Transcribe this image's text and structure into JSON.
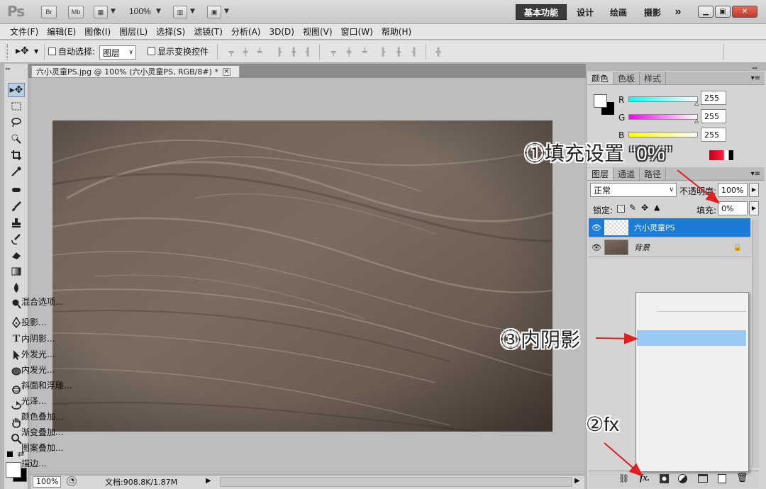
{
  "titlebar": {
    "app_logo": "Ps",
    "btn_br": "Br",
    "btn_mb": "Mb",
    "zoom": "100%",
    "workspaces": [
      "基本功能",
      "设计",
      "绘画",
      "摄影"
    ],
    "more": "»"
  },
  "menubar": [
    "文件(F)",
    "编辑(E)",
    "图像(I)",
    "图层(L)",
    "选择(S)",
    "滤镜(T)",
    "分析(A)",
    "3D(D)",
    "视图(V)",
    "窗口(W)",
    "帮助(H)"
  ],
  "options": {
    "auto_select_label": "自动选择:",
    "auto_select_value": "图层",
    "show_transform_label": "显示变换控件"
  },
  "document": {
    "tab_title": "六小灵童PS.jpg @ 100% (六小灵童PS, RGB/8#) *",
    "close": "×",
    "status_zoom": "100%",
    "status_doc": "文档:908.8K/1.87M"
  },
  "color_panel": {
    "tabs": [
      "颜色",
      "色板",
      "样式"
    ],
    "r_label": "R",
    "g_label": "G",
    "b_label": "B",
    "r_value": "255",
    "g_value": "255",
    "b_value": "255"
  },
  "layers_panel": {
    "tabs": [
      "图层",
      "通道",
      "路径"
    ],
    "blend_mode": "正常",
    "opacity_label": "不透明度:",
    "opacity_value": "100%",
    "lock_label": "锁定:",
    "fill_label": "填充:",
    "fill_value": "0%",
    "layers": [
      {
        "name": "六小灵童PS",
        "selected": true
      },
      {
        "name": "背景",
        "selected": false
      }
    ]
  },
  "context_menu": {
    "items": [
      "混合选项...",
      "投影...",
      "内阴影...",
      "外发光...",
      "内发光...",
      "斜面和浮雕...",
      "光泽...",
      "颜色叠加...",
      "渐变叠加...",
      "图案叠加...",
      "描边..."
    ],
    "highlighted": "内阴影..."
  },
  "annotations": {
    "step1": "①填充设置",
    "step1_value": "“0%”",
    "step2": "②fx",
    "step3": "③内阴影"
  },
  "colors": {
    "selected_layer": "#1c7bd4",
    "menu_highlight": "#99c9f4",
    "annotation_arrow": "#e02020"
  }
}
